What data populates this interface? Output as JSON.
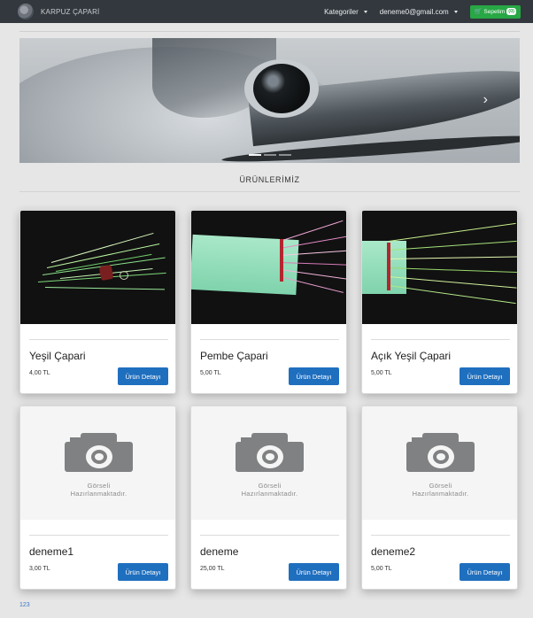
{
  "navbar": {
    "brand": "KARPUZ ÇAPARİ",
    "categories": "Kategoriler",
    "user": "deneme0@gmail.com",
    "cart": {
      "label": "Sepetim",
      "count": "(0)"
    }
  },
  "carousel": {
    "next_label": "›",
    "slides": 3,
    "active": 0
  },
  "section": {
    "title": "ÜRÜNLERİMİZ"
  },
  "detail_label": "Ürün Detayı",
  "placeholder": {
    "line1": "Görseli",
    "line2": "Hazırlanmaktadır."
  },
  "products": [
    {
      "name": "Yeşil Çapari",
      "price": "4,00 TL",
      "image": "green-fiber-lure"
    },
    {
      "name": "Pembe Çapari",
      "price": "5,00 TL",
      "image": "pink-fiber-on-foam"
    },
    {
      "name": "Açık Yeşil Çapari",
      "price": "5,00 TL",
      "image": "light-green-fiber-on-foam"
    },
    {
      "name": "deneme1",
      "price": "3,00 TL",
      "image": "placeholder"
    },
    {
      "name": "deneme",
      "price": "25,00 TL",
      "image": "placeholder"
    },
    {
      "name": "deneme2",
      "price": "5,00 TL",
      "image": "placeholder"
    }
  ],
  "footer": {
    "text": "123"
  },
  "colors": {
    "navbar": "#33383e",
    "cart": "#28a745",
    "button": "#1f6fbf",
    "link": "#3a78c5"
  }
}
